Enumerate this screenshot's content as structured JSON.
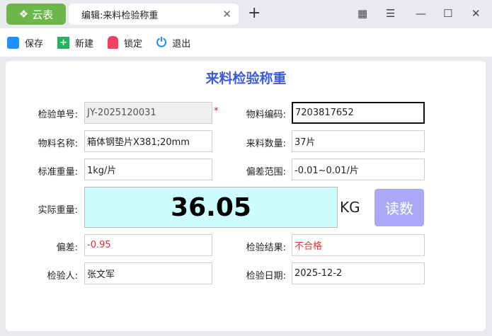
{
  "app": {
    "logo": "云表",
    "tab_title": "编辑:来料检验称重"
  },
  "toolbar": {
    "save": "保存",
    "new": "新建",
    "lock": "锁定",
    "exit": "退出"
  },
  "form": {
    "title": "来料检验称重",
    "inspection_no_label": "检验单号:",
    "inspection_no": "JY-2025120031",
    "required_mark": "*",
    "material_code_label": "物料编码:",
    "material_code": "7203817652",
    "material_name_label": "物料名称:",
    "material_name": "箱体钢垫片X381;20mm",
    "quantity_label": "来料数量:",
    "quantity": "37片",
    "std_weight_label": "标准重量:",
    "std_weight": "1kg/片",
    "tolerance_label": "偏差范围:",
    "tolerance": "-0.01~0.01/片",
    "actual_weight_label": "实际重量:",
    "actual_weight": "36.05",
    "unit": "KG",
    "read_button": "读数",
    "deviation_label": "偏差:",
    "deviation": "-0.95",
    "result_label": "检验结果:",
    "result": "不合格",
    "inspector_label": "检验人:",
    "inspector": "张文军",
    "date_label": "检验日期:",
    "date": "2025-12-2"
  }
}
